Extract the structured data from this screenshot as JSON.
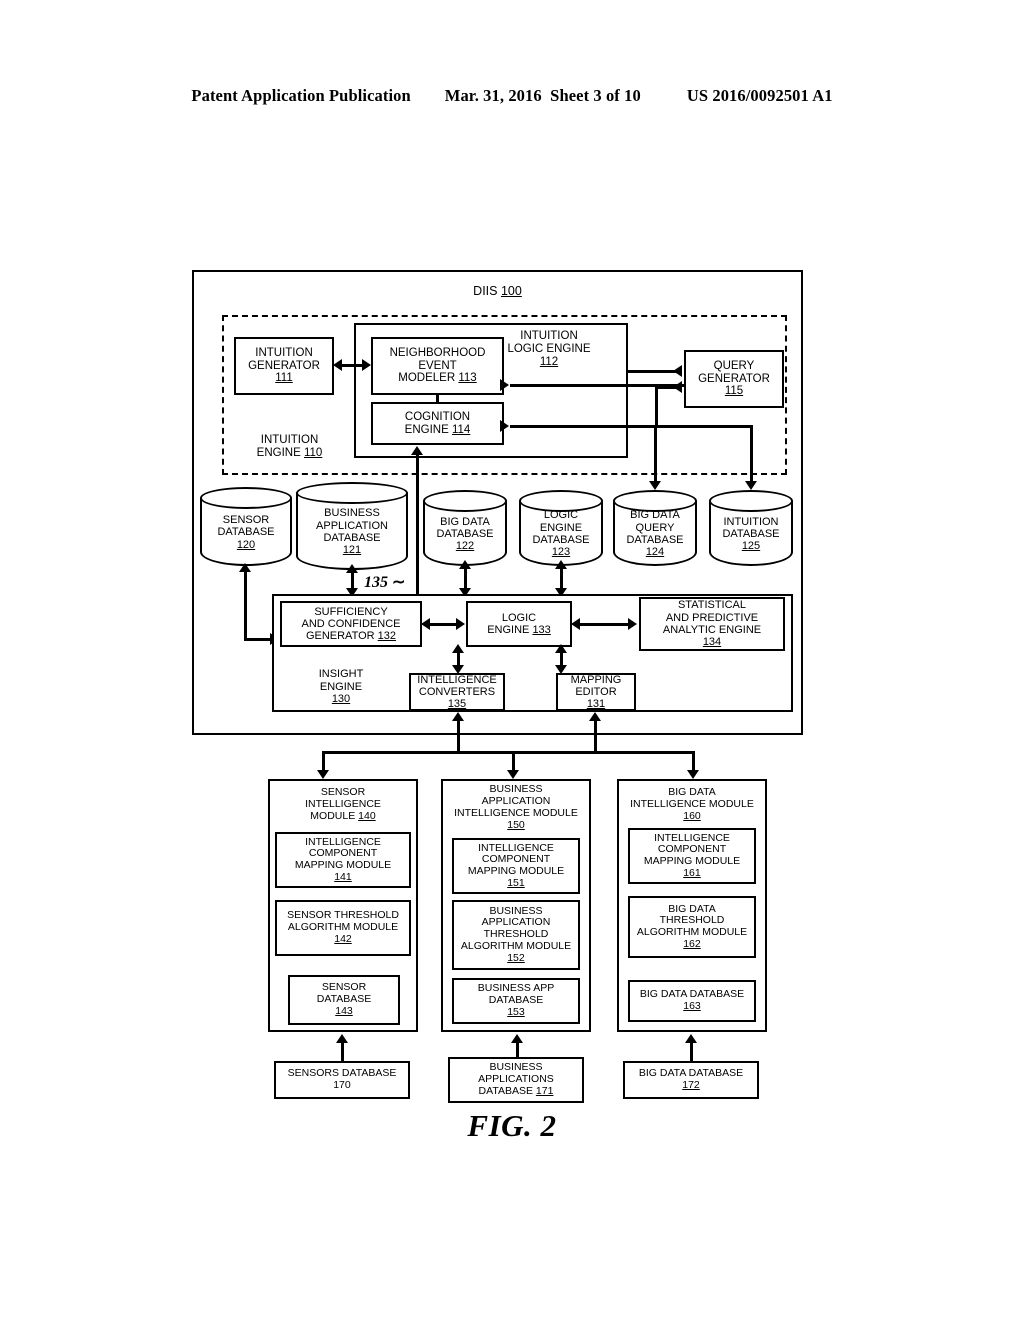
{
  "header": {
    "publication": "Patent Application Publication",
    "date_sheet": "Mar. 31, 2016  Sheet 3 of 10",
    "patent_number": "US 2016/0092501 A1"
  },
  "figure": {
    "label": "FIG. 2"
  },
  "diis": {
    "title": "DIIS",
    "ref": "100"
  },
  "intuition_engine": {
    "title_line1": "INTUITION",
    "title_line2": "ENGINE",
    "ref": "110",
    "logic_engine": {
      "line1": "INTUITION",
      "line2": "LOGIC ENGINE",
      "ref": "112"
    },
    "blocks": [
      {
        "name": "intuition-generator",
        "lines": [
          "INTUITION",
          "GENERATOR"
        ],
        "ref": "111"
      },
      {
        "name": "neighborhood-event-modeler",
        "lines": [
          "NEIGHBORHOOD",
          "EVENT",
          "MODELER"
        ],
        "ref": "113",
        "inline_ref": true
      },
      {
        "name": "cognition-engine",
        "lines": [
          "COGNITION",
          "ENGINE"
        ],
        "ref": "114",
        "inline_ref": true
      },
      {
        "name": "query-generator",
        "lines": [
          "QUERY",
          "GENERATOR"
        ],
        "ref": "115"
      }
    ]
  },
  "databases": [
    {
      "name": "sensor-database",
      "lines": [
        "SENSOR",
        "DATABASE"
      ],
      "ref": "120"
    },
    {
      "name": "business-application-database",
      "lines": [
        "BUSINESS",
        "APPLICATION",
        "DATABASE"
      ],
      "ref": "121"
    },
    {
      "name": "big-data-database",
      "lines": [
        "BIG DATA",
        "DATABASE"
      ],
      "ref": "122"
    },
    {
      "name": "logic-engine-database",
      "lines": [
        "LOGIC",
        "ENGINE",
        "DATABASE"
      ],
      "ref": "123"
    },
    {
      "name": "big-data-query-database",
      "lines": [
        "BIG DATA",
        "QUERY",
        "DATABASE"
      ],
      "ref": "124"
    },
    {
      "name": "intuition-database",
      "lines": [
        "INTUITION",
        "DATABASE"
      ],
      "ref": "125"
    }
  ],
  "insight_engine": {
    "title_line1": "INSIGHT",
    "title_line2": "ENGINE",
    "ref": "130",
    "connector_tag": "135",
    "blocks": [
      {
        "name": "sufficiency-and-confidence-generator",
        "lines": [
          "SUFFICIENCY",
          "AND CONFIDENCE",
          "GENERATOR"
        ],
        "ref": "132",
        "inline_ref": true
      },
      {
        "name": "logic-engine",
        "lines": [
          "LOGIC",
          "ENGINE"
        ],
        "ref": "133",
        "inline_ref": true
      },
      {
        "name": "statistical-and-predictive-analytic-engine",
        "lines": [
          "STATISTICAL",
          "AND PREDICTIVE",
          "ANALYTIC ENGINE"
        ],
        "ref": "134"
      },
      {
        "name": "intelligence-converters",
        "lines": [
          "INTELLIGENCE",
          "CONVERTERS"
        ],
        "ref": "135"
      },
      {
        "name": "mapping-editor",
        "lines": [
          "MAPPING",
          "EDITOR"
        ],
        "ref": "131"
      }
    ]
  },
  "modules": [
    {
      "name": "sensor-intelligence-module",
      "title_lines": [
        "SENSOR",
        "INTELLIGENCE",
        "MODULE"
      ],
      "ref": "140",
      "title_inline_ref": true,
      "children": [
        {
          "name": "intelligence-component-mapping-module",
          "lines": [
            "INTELLIGENCE",
            "COMPONENT",
            "MAPPING MODULE"
          ],
          "ref": "141"
        },
        {
          "name": "sensor-threshold-algorithm-module",
          "lines": [
            "SENSOR THRESHOLD",
            "ALGORITHM MODULE"
          ],
          "ref": "142"
        },
        {
          "name": "sensor-database-143",
          "lines": [
            "SENSOR",
            "DATABASE"
          ],
          "ref": "143"
        }
      ]
    },
    {
      "name": "business-application-intelligence-module",
      "title_lines": [
        "BUSINESS",
        "APPLICATION",
        "INTELLIGENCE MODULE"
      ],
      "ref": "150",
      "title_inline_ref": false,
      "children": [
        {
          "name": "intelligence-component-mapping-module",
          "lines": [
            "INTELLIGENCE",
            "COMPONENT",
            "MAPPING MODULE"
          ],
          "ref": "151"
        },
        {
          "name": "business-application-threshold-algorithm-module",
          "lines": [
            "BUSINESS",
            "APPLICATION",
            "THRESHOLD",
            "ALGORITHM MODULE"
          ],
          "ref": "152"
        },
        {
          "name": "business-app-database",
          "lines": [
            "BUSINESS APP",
            "DATABASE"
          ],
          "ref": "153"
        }
      ]
    },
    {
      "name": "big-data-intelligence-module",
      "title_lines": [
        "BIG DATA",
        "INTELLIGENCE MODULE"
      ],
      "ref": "160",
      "title_inline_ref": false,
      "children": [
        {
          "name": "intelligence-component-mapping-module",
          "lines": [
            "INTELLIGENCE",
            "COMPONENT",
            "MAPPING MODULE"
          ],
          "ref": "161"
        },
        {
          "name": "big-data-threshold-algorithm-module",
          "lines": [
            "BIG DATA",
            "THRESHOLD",
            "ALGORITHM MODULE"
          ],
          "ref": "162"
        },
        {
          "name": "big-data-database-163",
          "lines": [
            "BIG DATA DATABASE"
          ],
          "ref": "163"
        }
      ]
    }
  ],
  "bottom_databases": [
    {
      "name": "sensors-database",
      "lines": [
        "SENSORS DATABASE"
      ],
      "ref": "170",
      "underlined": false
    },
    {
      "name": "business-applications-database",
      "lines": [
        "BUSINESS",
        "APPLICATIONS",
        "DATABASE"
      ],
      "ref": "171",
      "underlined": true,
      "inline_ref": true
    },
    {
      "name": "big-data-database-172",
      "lines": [
        "BIG DATA DATABASE"
      ],
      "ref": "172",
      "underlined": true
    }
  ]
}
